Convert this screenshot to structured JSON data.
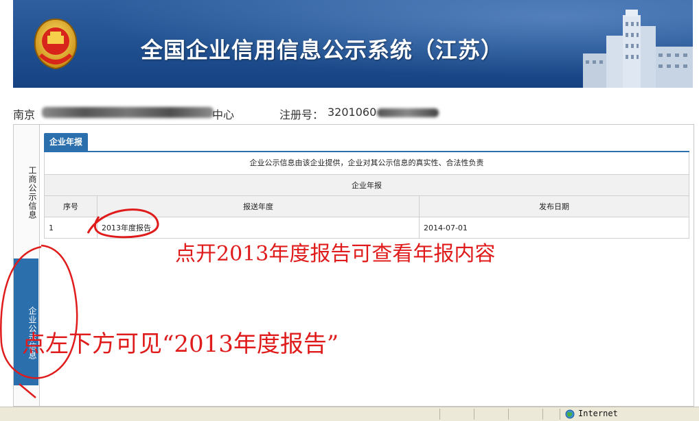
{
  "banner": {
    "title": "全国企业信用信息公示系统（江苏）",
    "emblem_icon": "national-emblem-icon",
    "building_icon": "building-icon",
    "colors": {
      "bg_top": "#2f5f9e",
      "bg_bottom": "#164282"
    }
  },
  "info": {
    "company_prefix": "南京",
    "company_suffix": "中心",
    "reg_label": "注册号：",
    "reg_number": "3201060"
  },
  "sidenav": {
    "items": [
      {
        "label": "工商公示信息",
        "active": false
      },
      {
        "label": "企业公示信息",
        "active": true
      }
    ],
    "active_color": "#2b6fad"
  },
  "content": {
    "tab_label": "企业年报",
    "notice": "企业公示信息由该企业提供，企业对其公示信息的真实性、合法性负责",
    "table": {
      "caption": "企业年报",
      "columns": [
        "序号",
        "报送年度",
        "发布日期"
      ],
      "rows": [
        {
          "index": "1",
          "year": "2013年度报告",
          "date": "2014-07-01"
        }
      ]
    }
  },
  "annotations": {
    "top_text": "点开2013年度报告可查看年报内容",
    "bottom_text": "点左下方可见“2013年度报告”",
    "color": "#e01b1b"
  },
  "statusbar": {
    "zone": "Internet",
    "zone_icon": "globe-icon"
  }
}
